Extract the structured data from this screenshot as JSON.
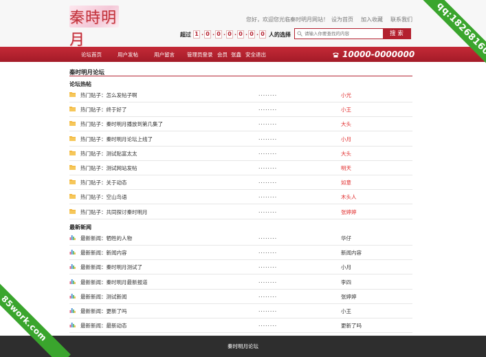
{
  "header": {
    "logo_text": "秦時明月",
    "greeting": "您好，欢迎您光临秦时明月网站！",
    "links": [
      "设为首页",
      "加入收藏",
      "联系我们"
    ],
    "count_prefix": "超过",
    "count_digits": [
      "1",
      "0",
      "0",
      "0",
      "0",
      "0",
      "0"
    ],
    "count_suffix": "人的选择",
    "search_placeholder": "请输入你要查找的内容",
    "search_button": "搜 索"
  },
  "nav": {
    "items": [
      "论坛首页",
      "用户发帖",
      "用户留言",
      "管理员登录",
      "会员",
      "张鑫",
      "安全退出"
    ],
    "phone": "10000-0000000"
  },
  "main": {
    "title": "秦时明月论坛",
    "hot_section": {
      "title": "论坛热帖",
      "rows": [
        {
          "title": "热门贴子：怎么发帖子啊",
          "dots": "........",
          "author": "小光"
        },
        {
          "title": "热门贴子：终于好了",
          "dots": "........",
          "author": "小王"
        },
        {
          "title": "热门贴子：秦时明月播放到第几集了",
          "dots": "........",
          "author": "大头"
        },
        {
          "title": "热门贴子：秦时明月论坛上线了",
          "dots": "........",
          "author": "小月"
        },
        {
          "title": "热门贴子：测试贴富太太",
          "dots": "........",
          "author": "大头"
        },
        {
          "title": "热门贴子：测试网站发帖",
          "dots": "........",
          "author": "明天"
        },
        {
          "title": "热门贴子：关于动态",
          "dots": "........",
          "author": "如意"
        },
        {
          "title": "热门贴子：空山鸟语",
          "dots": "........",
          "author": "木头人"
        },
        {
          "title": "热门贴子：共同探讨秦时明月",
          "dots": "........",
          "author": "张婷婷"
        }
      ]
    },
    "news_section": {
      "title": "最新新闻",
      "rows": [
        {
          "title": "最新新闻：牺牲的人物",
          "dots": "........",
          "author": "华仔"
        },
        {
          "title": "最新新闻：新闻内容",
          "dots": "........",
          "author": "新闻内容"
        },
        {
          "title": "最新新闻：秦时明月测试了",
          "dots": "........",
          "author": "小月"
        },
        {
          "title": "最新新闻：秦时明月最新报道",
          "dots": "........",
          "author": "李四"
        },
        {
          "title": "最新新闻：测试新闻",
          "dots": "........",
          "author": "张婷婷"
        },
        {
          "title": "最新新闻：更新了吗",
          "dots": "........",
          "author": "小王"
        },
        {
          "title": "最新新闻：最新动态",
          "dots": "........",
          "author": "更新了吗"
        }
      ]
    }
  },
  "footer": {
    "text": "秦时明月论坛"
  },
  "watermarks": {
    "top_right": "qq:1826816020",
    "bottom_left": "85work.com"
  },
  "colors": {
    "brand_red": "#b3202e",
    "author_red": "#e02c2c",
    "watermark_green": "#3aa52d",
    "footer_bg": "#2e2e2e"
  }
}
